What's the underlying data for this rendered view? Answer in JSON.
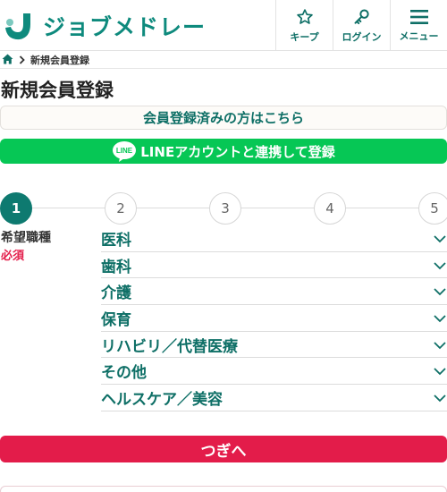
{
  "header": {
    "logo_text": "ジョブメドレー",
    "keep_label": "キープ",
    "login_label": "ログイン",
    "menu_label": "メニュー",
    "brand_color": "#0e8a7d"
  },
  "breadcrumb": {
    "current": "新規会員登録"
  },
  "page_title": "新規会員登録",
  "login_link": "会員登録済みの方はこちら",
  "line_button": {
    "badge": "LINE",
    "label": "LINEアカウントと連携して登録",
    "color": "#06c755"
  },
  "stepper": {
    "current": 1,
    "steps": [
      "1",
      "2",
      "3",
      "4",
      "5"
    ]
  },
  "form": {
    "field_label": "希望職種",
    "required_label": "必須",
    "options": [
      "医科",
      "歯科",
      "介護",
      "保育",
      "リハビリ／代替医療",
      "その他",
      "ヘルスケア／美容"
    ]
  },
  "next_button": {
    "label": "つぎへ",
    "color": "#e31c4a"
  }
}
